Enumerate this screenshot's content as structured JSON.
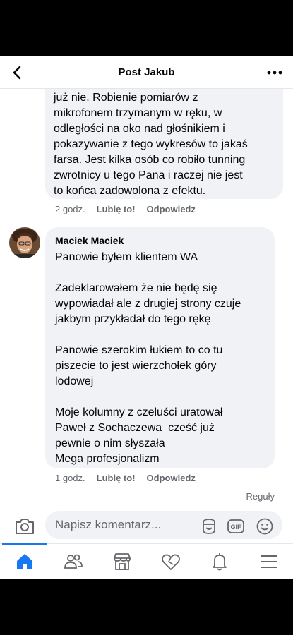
{
  "header": {
    "title": "Post Jakub"
  },
  "comments": [
    {
      "text": "już nie. Robienie pomiarów z\nmikrofonem trzymanym w ręku, w\nodległości na oko nad głośnikiem i\npokazywanie z tego wykresów to jakaś\nfarsa. Jest kilka osób co robiło tunning\nzwrotnicy u tego Pana i raczej nie jest\nto końca zadowolona z efektu.",
      "time": "2 godz.",
      "like": "Lubię to!",
      "reply": "Odpowiedz"
    },
    {
      "author": "Maciek Maciek",
      "text": "Panowie byłem klientem WA\n\nZadeklarowałem że nie będę się\nwypowiadał ale z drugiej strony czuje\njakbym przykładał do tego rękę\n\nPanowie szerokim łukiem to co tu\npiszecie to jest wierzchołek góry\nlodowej\n\nMoje kolumny z czeluści uratował\nPaweł z Sochaczewa  cześć już\npewnie o nim słyszała\nMega profesjonalizm",
      "time": "1 godz.",
      "like": "Lubię to!",
      "reply": "Odpowiedz"
    }
  ],
  "rules_label": "Reguły",
  "composer": {
    "placeholder": "Napisz komentarz...",
    "gif_label": "GIF"
  },
  "nav": {
    "items": [
      "home-icon",
      "friends-icon",
      "marketplace-icon",
      "dating-icon",
      "notifications-icon",
      "menu-icon"
    ],
    "active_color": "#1877f2"
  },
  "colors": {
    "bubble": "#f0f2f5",
    "meta": "#65676b",
    "icon": "#65676b"
  }
}
